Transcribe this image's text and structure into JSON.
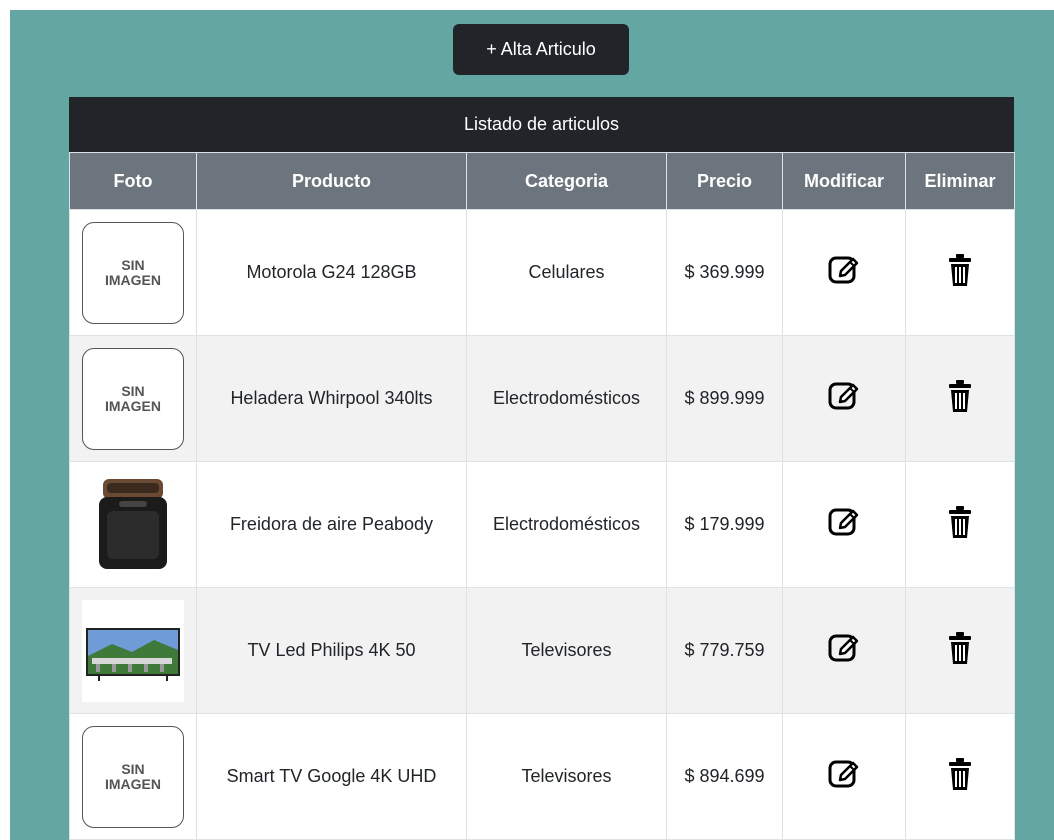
{
  "toolbar": {
    "alta_label": "+ Alta Articulo"
  },
  "table": {
    "caption": "Listado de articulos",
    "headers": [
      "Foto",
      "Producto",
      "Categoria",
      "Precio",
      "Modificar",
      "Eliminar"
    ],
    "no_image_text": [
      "SIN",
      "IMAGEN"
    ],
    "rows": [
      {
        "image": "sin-imagen",
        "producto": "Motorola G24 128GB",
        "categoria": "Celulares",
        "precio": "$ 369.999"
      },
      {
        "image": "sin-imagen",
        "producto": "Heladera Whirpool 340lts",
        "categoria": "Electrodomésticos",
        "precio": "$ 899.999"
      },
      {
        "image": "air-fryer-photo",
        "producto": "Freidora de aire Peabody",
        "categoria": "Electrodomésticos",
        "precio": "$ 179.999"
      },
      {
        "image": "tv-photo",
        "producto": "TV Led Philips 4K 50",
        "categoria": "Televisores",
        "precio": "$ 779.759"
      },
      {
        "image": "sin-imagen",
        "producto": "Smart TV Google 4K UHD",
        "categoria": "Televisores",
        "precio": "$ 894.699"
      }
    ]
  },
  "icons": {
    "modify": "pencil-square-icon",
    "delete": "trash-icon"
  },
  "colors": {
    "background": "#64a6a1",
    "dark": "#212529",
    "header": "#6c757d",
    "stripe": "#f2f2f2"
  }
}
